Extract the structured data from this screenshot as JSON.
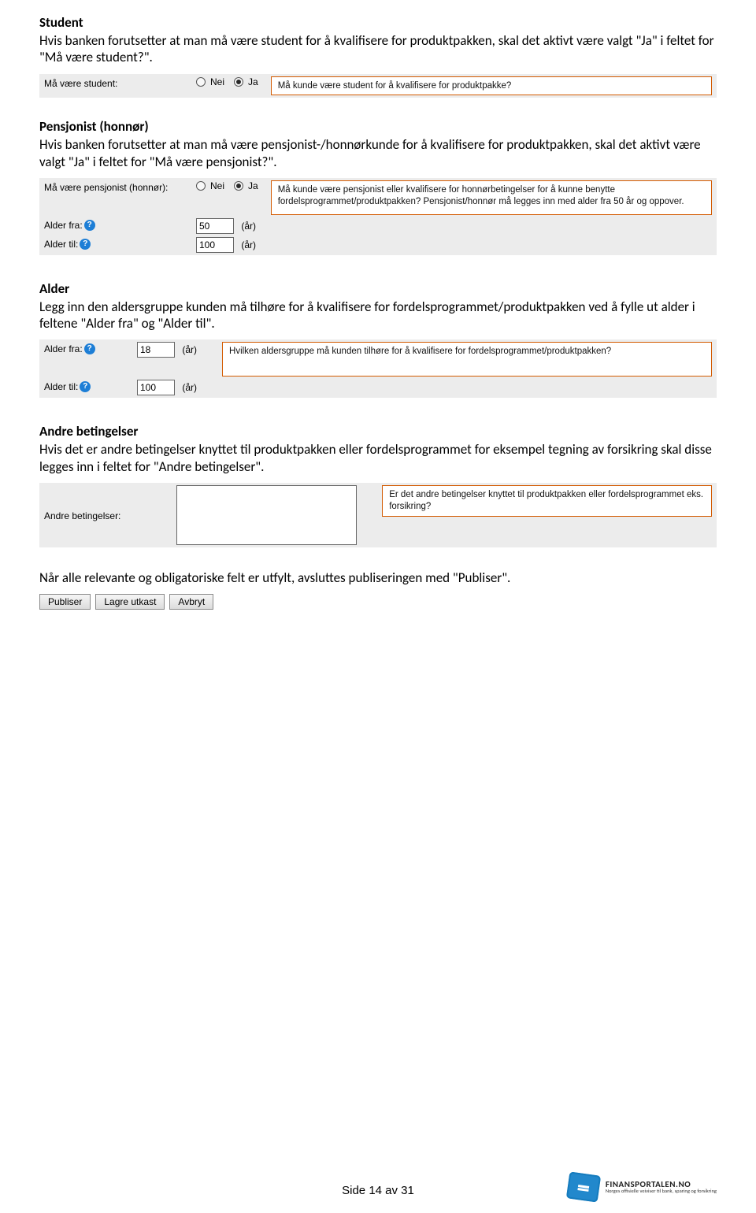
{
  "sections": {
    "student": {
      "title": "Student",
      "body": "Hvis banken forutsetter at man må være student for å kvalifisere for produktpakken, skal det aktivt være valgt \"Ja\" i feltet for \"Må være student?\".",
      "label": "Må være student:",
      "radio_nei": "Nei",
      "radio_ja": "Ja",
      "tooltip": "Må kunde være student for å kvalifisere for produktpakke?"
    },
    "pensjonist": {
      "title": "Pensjonist (honnør)",
      "body": "Hvis banken forutsetter at man må være pensjonist-/honnørkunde for å kvalifisere for produktpakken, skal det aktivt være valgt \"Ja\" i feltet for \"Må være pensjonist?\".",
      "row_label": "Må være pensjonist (honnør):",
      "radio_nei": "Nei",
      "radio_ja": "Ja",
      "tooltip": "Må kunde være pensjonist eller kvalifisere for honnørbetingelser for å kunne benytte fordelsprogrammet/produktpakken? Pensjonist/honnør må legges inn med alder fra 50 år og oppover.",
      "alder_fra_label": "Alder fra:",
      "alder_fra_value": "50",
      "alder_til_label": "Alder til:",
      "alder_til_value": "100",
      "unit": "(år)"
    },
    "alder": {
      "title": "Alder",
      "body": "Legg inn den aldersgruppe kunden må tilhøre for å kvalifisere for fordelsprogrammet/produktpakken ved å fylle ut alder i feltene \"Alder fra\" og \"Alder til\".",
      "alder_fra_label": "Alder fra:",
      "alder_fra_value": "18",
      "alder_til_label": "Alder til:",
      "alder_til_value": "100",
      "unit": "(år)",
      "tooltip": "Hvilken aldersgruppe må kunden tilhøre for å kvalifisere for fordelsprogrammet/produktpakken?"
    },
    "andre": {
      "title": "Andre betingelser",
      "body": "Hvis det er andre betingelser knyttet til produktpakken eller fordelsprogrammet for eksempel tegning av forsikring skal disse legges inn i feltet for \"Andre betingelser\".",
      "label": "Andre betingelser:",
      "tooltip": "Er det andre betingelser knyttet til produktpakken eller fordelsprogrammet eks. forsikring?"
    },
    "publiser": {
      "body": "Når alle relevante og obligatoriske felt er utfylt, avsluttes publiseringen med \"Publiser\".",
      "btn_publiser": "Publiser",
      "btn_lagre": "Lagre utkast",
      "btn_avbryt": "Avbryt"
    }
  },
  "footer": {
    "page": "Side 14 av 31",
    "brand_main": "FINANSPORTALEN.NO",
    "brand_sub": "Norges offisielle veiviser til bank, sparing og forsikring"
  }
}
